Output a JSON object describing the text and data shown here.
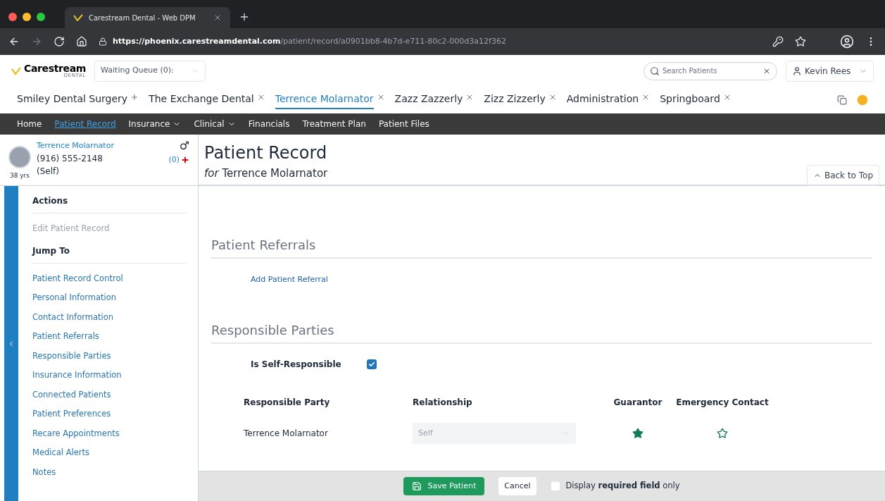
{
  "browser": {
    "tab_title": "Carestream Dental - Web DPM",
    "url_host": "https://phoenix.carestreamdental.com",
    "url_path": "/patient/record/a0901bb8-4b7d-e711-80c2-000d3a12f362"
  },
  "header": {
    "logo": "Carestream",
    "logo_sub": "DENTAL",
    "waiting_queue": "Waiting Queue (0):",
    "search": {
      "placeholder": "Search Patients"
    },
    "user": "Kevin Rees"
  },
  "workspace_tabs": [
    {
      "label": "Smiley Dental Surgery",
      "kind": "add",
      "selected": false
    },
    {
      "label": "The Exchange Dental",
      "kind": "close",
      "selected": false
    },
    {
      "label": "Terrence Molarnator",
      "kind": "close",
      "selected": true
    },
    {
      "label": "Zazz Zazzerly",
      "kind": "close",
      "selected": false
    },
    {
      "label": "Zizz Zizzerly",
      "kind": "close",
      "selected": false
    },
    {
      "label": "Administration",
      "kind": "close",
      "selected": false
    },
    {
      "label": "Springboard",
      "kind": "close",
      "selected": false
    }
  ],
  "nav": [
    {
      "label": "Home",
      "dropdown": false,
      "selected": false
    },
    {
      "label": "Patient Record",
      "dropdown": false,
      "selected": true
    },
    {
      "label": "Insurance",
      "dropdown": true,
      "selected": false
    },
    {
      "label": "Clinical",
      "dropdown": true,
      "selected": false
    },
    {
      "label": "Financials",
      "dropdown": false,
      "selected": false
    },
    {
      "label": "Treatment Plan",
      "dropdown": false,
      "selected": false
    },
    {
      "label": "Patient Files",
      "dropdown": false,
      "selected": false
    }
  ],
  "patient": {
    "name": "Terrence Molarnator",
    "phone": "(916) 555-2148",
    "relation": "(Self)",
    "age": "38 yrs",
    "gender": "♂",
    "alerts": "(0)"
  },
  "page": {
    "title": "Patient Record",
    "subtitle": "*for* Terrence Molarnator",
    "back_to_top": "Back to Top"
  },
  "sidebar": [
    {
      "heading": "Actions",
      "items": [
        {
          "label": "Edit Patient Record",
          "disabled": true
        }
      ]
    },
    {
      "heading": "Jump To",
      "items": [
        {
          "label": "Patient Record Control",
          "disabled": false
        },
        {
          "label": "Personal Information",
          "disabled": false
        },
        {
          "label": "Contact Information",
          "disabled": false
        },
        {
          "label": "Patient Referrals",
          "disabled": false
        },
        {
          "label": "Responsible Parties",
          "disabled": false
        },
        {
          "label": "Insurance Information",
          "disabled": false
        },
        {
          "label": "Connected Patients",
          "disabled": false
        },
        {
          "label": "Patient Preferences",
          "disabled": false
        },
        {
          "label": "Recare Appointments",
          "disabled": false
        },
        {
          "label": "Medical Alerts",
          "disabled": false
        },
        {
          "label": "Notes",
          "disabled": false
        }
      ]
    }
  ],
  "referrals": {
    "title": "Patient Referrals",
    "link": "Add Patient Referral"
  },
  "responsible": {
    "title": "Responsible Parties",
    "self_label": "Is Self-Responsible",
    "self_checked": true,
    "columns": [
      "Responsible Party",
      "Relationship",
      "Guarantor",
      "Emergency Contact"
    ],
    "rows": [
      {
        "party": "Terrence Molarnator",
        "relationship": "Self",
        "guarantor": true,
        "emergency": false
      }
    ]
  },
  "footer": {
    "save": "Save Patient",
    "cancel": "Cancel",
    "required_only": "Display **required field** only",
    "required_checked": false
  }
}
